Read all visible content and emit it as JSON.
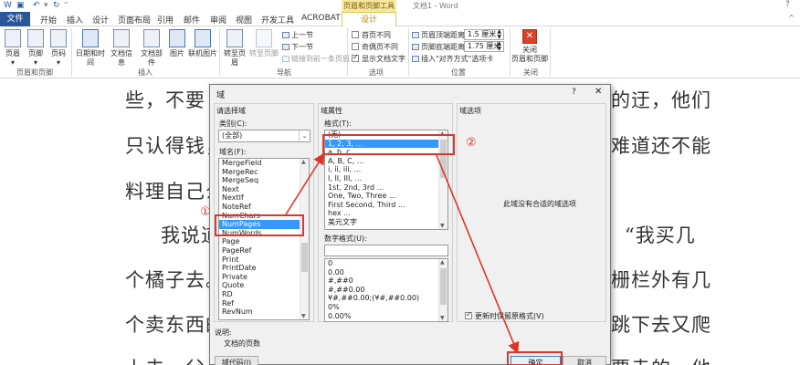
{
  "title_bar": {
    "doc_title": "文档1 - Word",
    "context_tab_group": "页眉和页脚工具",
    "help": "?"
  },
  "tabs": {
    "file": "文件",
    "items": [
      "开始",
      "插入",
      "设计",
      "页面布局",
      "引用",
      "邮件",
      "审阅",
      "视图",
      "开发工具",
      "ACROBAT"
    ],
    "design": "设计"
  },
  "ribbon": {
    "header_footer_group": {
      "buttons": [
        "页眉",
        "页脚",
        "页码"
      ],
      "label": "页眉和页脚"
    },
    "insert_group": {
      "buttons": [
        "日期和时间",
        "文档信息",
        "文档部件",
        "图片",
        "联机图片"
      ],
      "label": "插入"
    },
    "nav_group": {
      "goto_header": "转至页眉",
      "goto_footer": "转至页脚",
      "prev": "上一节",
      "next": "下一节",
      "link_prev": "链接到前一条页眉",
      "label": "导航"
    },
    "options_group": {
      "diff_first": "首页不同",
      "odd_even": "奇偶页不同",
      "show_text": "显示文档文字",
      "show_text_checked": true,
      "label": "选项"
    },
    "position_group": {
      "header_top_label": "页眉顶端距离:",
      "header_top_value": "1.5 厘米",
      "footer_bottom_label": "页脚底端距离:",
      "footer_bottom_value": "1.75 厘米",
      "insert_align_tab": "插入\"对齐方式\"选项卡",
      "label": "位置"
    },
    "close_group": {
      "close_label_1": "关闭",
      "close_label_2": "页眉和页脚",
      "label": "关闭"
    }
  },
  "document": {
    "lines": [
      {
        "left": "些，不要",
        "right": "的迂，他们"
      },
      {
        "left": "只认得钱，",
        "right": "难道还不能"
      },
      {
        "left": "料理自己么",
        "right": ""
      },
      {
        "left": "我说道",
        "right": "“我买几"
      },
      {
        "left": "个橘子去。",
        "right": "栅栏外有几"
      },
      {
        "left": "个卖东西的",
        "right": "跳下去又爬"
      },
      {
        "left": "上去。父",
        "right": "要走的。他"
      }
    ]
  },
  "dialog": {
    "title": "域",
    "help": "?",
    "close": "✕",
    "choose_field_label": "请选择域",
    "category_label": "类别(C):",
    "category_value": "(全部)",
    "field_names_label": "域名(F):",
    "field_names": [
      "MergeField",
      "MergeRec",
      "MergeSeq",
      "Next",
      "NextIf",
      "NoteRef",
      "NumChars",
      "NumPages",
      "NumWords",
      "Page",
      "PageRef",
      "Print",
      "PrintDate",
      "Private",
      "Quote",
      "RD",
      "Ref",
      "RevNum"
    ],
    "selected_field": "NumPages",
    "field_properties_label": "域属性",
    "format_label": "格式(T):",
    "formats": [
      "(无)",
      "1, 2, 3, ...",
      "a, b, c, ...",
      "A, B, C, ...",
      "i, ii, iii, ...",
      "I, II, III, ...",
      "1st, 2nd, 3rd ...",
      "One, Two, Three ...",
      "First Second, Third ...",
      "hex ...",
      "美元文字"
    ],
    "selected_format": "1, 2, 3, ...",
    "numeric_format_label": "数字格式(U):",
    "numeric_formats": [
      "0",
      "0.00",
      "#,##0",
      "#,##0.00",
      "¥#,##0.00;(¥#,##0.00)",
      "0%",
      "0.00%"
    ],
    "field_options_label": "域选项",
    "no_options_text": "此域没有合适的域选项",
    "preserve_format_label": "更新时保留原格式(V)",
    "preserve_format_checked": true,
    "description_label": "说明:",
    "description_text": "文档的页数",
    "field_codes_button": "域代码(I)",
    "ok_button": "确定",
    "cancel_button": "取消"
  },
  "annotations": {
    "marker_1": "①",
    "marker_2": "②",
    "color": "#e0352b"
  }
}
